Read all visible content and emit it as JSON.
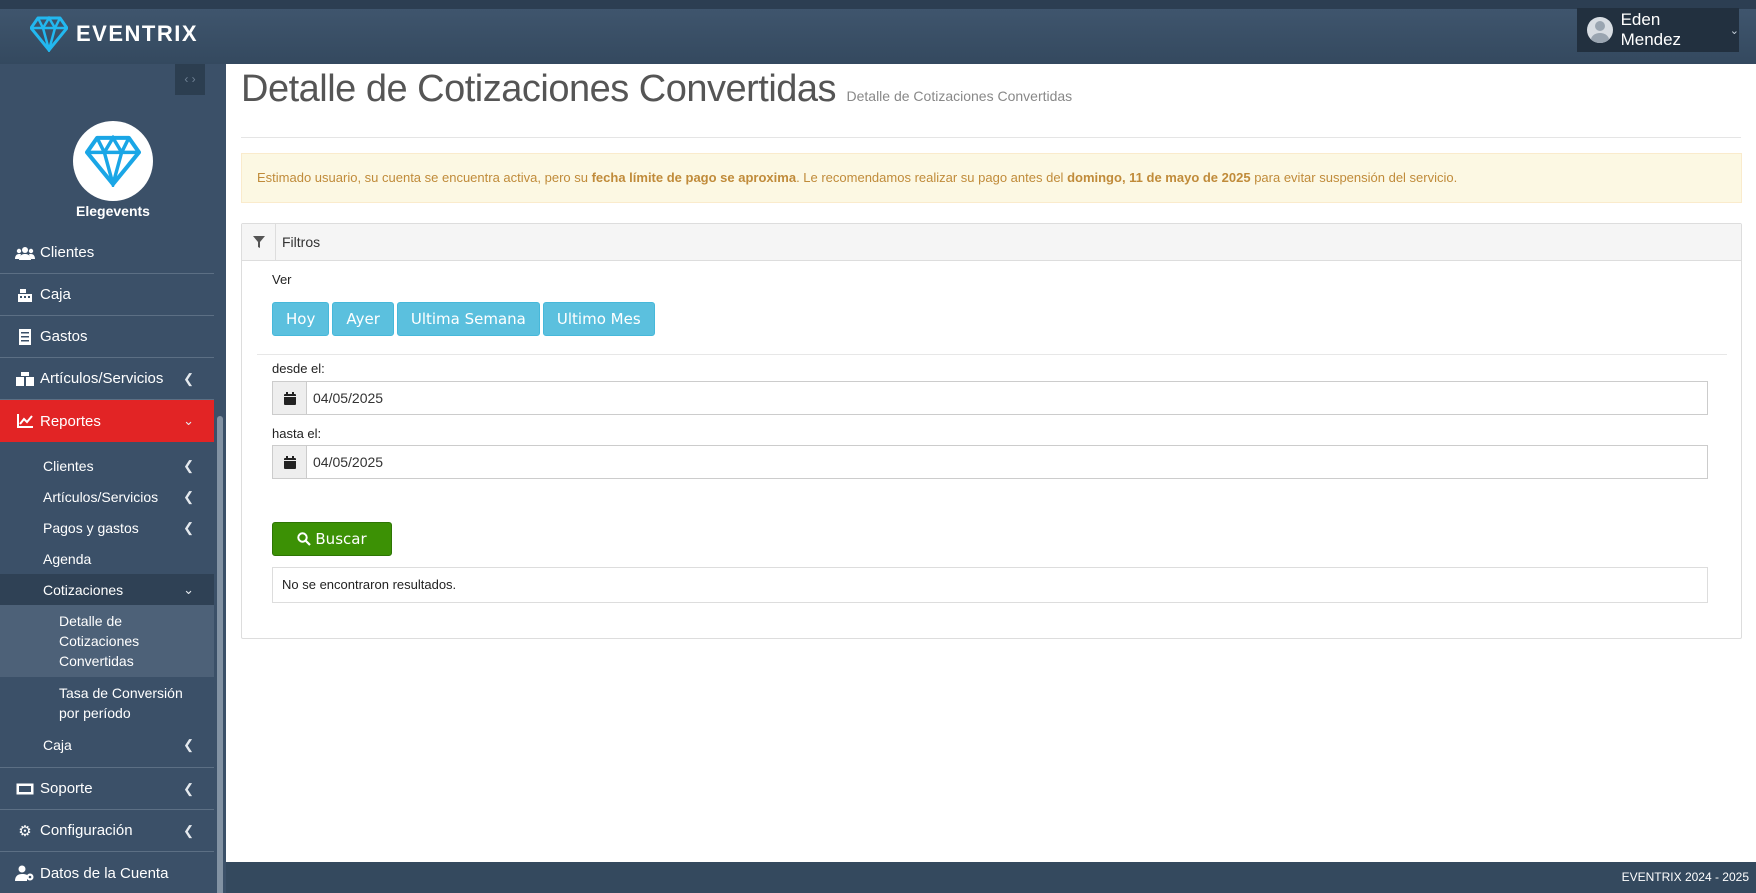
{
  "app": {
    "brand": "EVENTRIX",
    "org_name": "Elegevents"
  },
  "user": {
    "name": "Eden Mendez"
  },
  "colors": {
    "active_nav": "#e22425",
    "info_button": "#5bc0de",
    "success_button": "#3c9105",
    "alert_text": "#c08b3a"
  },
  "sidebar": {
    "items": [
      {
        "label": "Clientes",
        "icon": "users-icon"
      },
      {
        "label": "Caja",
        "icon": "cash-register-icon"
      },
      {
        "label": "Gastos",
        "icon": "receipt-icon"
      },
      {
        "label": "Artículos/Servicios",
        "icon": "boxes-icon"
      },
      {
        "label": "Reportes",
        "icon": "chart-line-icon"
      }
    ],
    "reportes_sub": [
      {
        "label": "Clientes"
      },
      {
        "label": "Artículos/Servicios"
      },
      {
        "label": "Pagos y gastos"
      },
      {
        "label": "Agenda"
      },
      {
        "label": "Cotizaciones"
      }
    ],
    "cotizaciones_sub": [
      {
        "label": "Detalle de Cotizaciones Convertidas"
      },
      {
        "label": "Tasa de Conversión por período"
      }
    ],
    "caja_sub": {
      "label": "Caja"
    },
    "bottom_items": [
      {
        "label": "Soporte",
        "icon": "ticket-icon"
      },
      {
        "label": "Configuración",
        "icon": "gear-icon"
      },
      {
        "label": "Datos de la Cuenta",
        "icon": "user-cog-icon"
      }
    ]
  },
  "page": {
    "title": "Detalle de Cotizaciones Convertidas",
    "subtitle": "Detalle de Cotizaciones Convertidas"
  },
  "alert": {
    "part1": "Estimado usuario, su cuenta se encuentra activa, pero su ",
    "bold1": "fecha límite de pago se aproxima",
    "part2": ". Le recomendamos realizar su pago antes del ",
    "bold2": "domingo, 11 de mayo de 2025",
    "part3": " para evitar suspensión del servicio."
  },
  "filters": {
    "header": "Filtros",
    "ver_label": "Ver",
    "quick_buttons": [
      "Hoy",
      "Ayer",
      "Ultima Semana",
      "Ultimo Mes"
    ],
    "desde_label": "desde el:",
    "desde_value": "04/05/2025",
    "hasta_label": "hasta el:",
    "hasta_value": "04/05/2025",
    "search_label": "Buscar",
    "no_results": "No se encontraron resultados."
  },
  "footer": {
    "text": "EVENTRIX 2024 - 2025"
  }
}
